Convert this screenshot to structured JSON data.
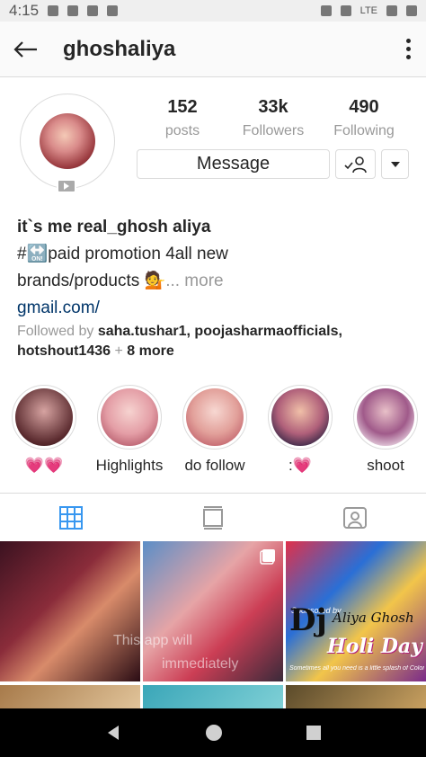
{
  "status_bar": {
    "time": "4:15",
    "network": "LTE"
  },
  "header": {
    "username": "ghoshaliya"
  },
  "profile": {
    "stats": [
      {
        "value": "152",
        "label": "posts"
      },
      {
        "value": "33k",
        "label": "Followers"
      },
      {
        "value": "490",
        "label": "Following"
      }
    ],
    "message_button": "Message",
    "bio": {
      "name": "it`s me real_ghosh aliya",
      "line1": "#🔛paid promotion 4all new",
      "line2": " brands/products 💁",
      "more": "... more",
      "link": "gmail.com/"
    },
    "followed_by": {
      "prefix": "Followed by ",
      "names": "saha.tushar1, poojasharmaofficials,",
      "names2": "hotshout1436",
      "suffix_sep": " + ",
      "more": "8 more"
    }
  },
  "highlights": [
    {
      "label": "💗💗"
    },
    {
      "label": "Highlights"
    },
    {
      "label": "do follow"
    },
    {
      "label": ":💗"
    },
    {
      "label": "shoot"
    }
  ],
  "posts": {
    "overlay_text_1": "This app will",
    "overlay_text_2": "immediately",
    "poster_title": "Dj",
    "poster_name": "Aliya Ghosh",
    "poster_event": "Holi Day",
    "poster_sponsor": "Sponsored by",
    "poster_tagline": "Sometimes all you need is a little splash of Colors"
  },
  "colors": {
    "link": "#003569",
    "accent_tab": "#3897f0",
    "muted": "#999999"
  }
}
